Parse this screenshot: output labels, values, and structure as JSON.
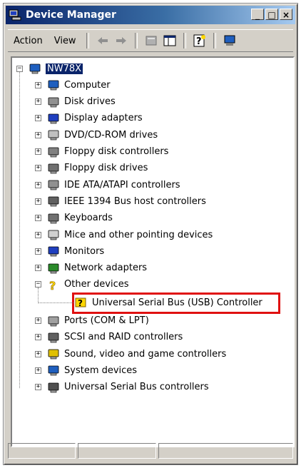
{
  "window": {
    "title": "Device Manager"
  },
  "caption": {
    "minimize": "_",
    "maximize": "□",
    "close": "×"
  },
  "menu": {
    "action": "Action",
    "view": "View"
  },
  "toolbar": {
    "buttons": [
      "back-arrow-icon",
      "forward-arrow-icon",
      "properties-icon",
      "show-hide-tree-icon",
      "help-icon",
      "computer-icon"
    ]
  },
  "tree": {
    "root": "NW78X",
    "categories": [
      {
        "label": "Computer",
        "icon": "computer-icon"
      },
      {
        "label": "Disk drives",
        "icon": "disk-drive-icon"
      },
      {
        "label": "Display adapters",
        "icon": "display-adapter-icon"
      },
      {
        "label": "DVD/CD-ROM drives",
        "icon": "cdrom-icon"
      },
      {
        "label": "Floppy disk controllers",
        "icon": "floppy-controller-icon"
      },
      {
        "label": "Floppy disk drives",
        "icon": "floppy-drive-icon"
      },
      {
        "label": "IDE ATA/ATAPI controllers",
        "icon": "ide-controller-icon"
      },
      {
        "label": "IEEE 1394 Bus host controllers",
        "icon": "ieee1394-icon"
      },
      {
        "label": "Keyboards",
        "icon": "keyboard-icon"
      },
      {
        "label": "Mice and other pointing devices",
        "icon": "mouse-icon"
      },
      {
        "label": "Monitors",
        "icon": "monitor-icon"
      },
      {
        "label": "Network adapters",
        "icon": "network-adapter-icon"
      },
      {
        "label": "Other devices",
        "icon": "unknown-device-icon",
        "expanded": true
      },
      {
        "label": "Ports (COM & LPT)",
        "icon": "port-icon"
      },
      {
        "label": "SCSI and RAID controllers",
        "icon": "scsi-icon"
      },
      {
        "label": "Sound, video and game controllers",
        "icon": "sound-icon"
      },
      {
        "label": "System devices",
        "icon": "system-device-icon"
      },
      {
        "label": "Universal Serial Bus controllers",
        "icon": "usb-icon"
      }
    ],
    "other_child": "Universal Serial Bus (USB) Controller"
  },
  "colors": {
    "titlebar": "#0a246a",
    "highlight_border": "#e01010",
    "selection": "#0a246a"
  }
}
